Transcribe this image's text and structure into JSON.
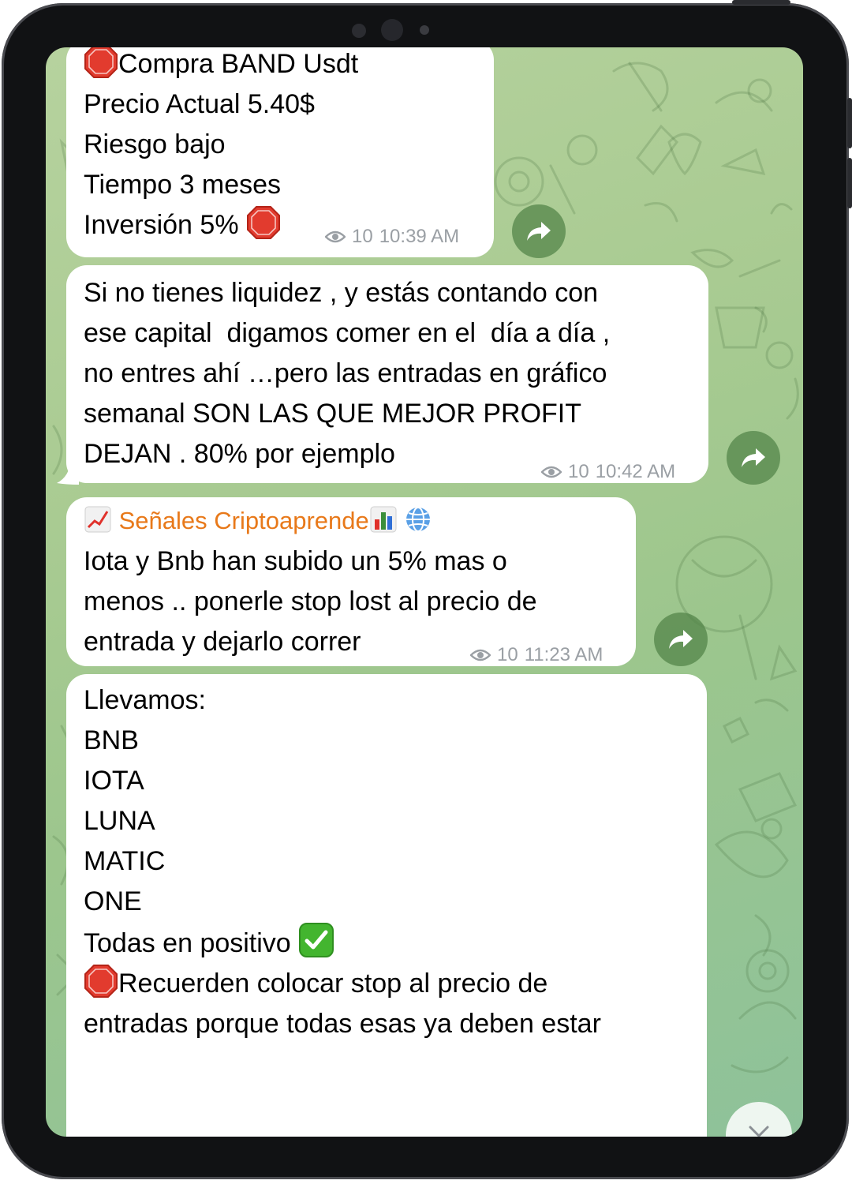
{
  "messages": [
    {
      "lines": [
        "Compra BAND Usdt",
        "Precio Actual 5.40$",
        "Riesgo bajo",
        "Tiempo 3 meses",
        "Inversión 5%"
      ],
      "views": "10",
      "time": "10:39 AM"
    },
    {
      "lines": [
        "Si no tienes liquidez , y estás contando con",
        "ese capital  digamos comer en el  día a día ,",
        "no entres ahí …pero las entradas en gráfico",
        "semanal SON LAS QUE MEJOR PROFIT",
        "DEJAN . 80% por ejemplo"
      ],
      "views": "10",
      "time": "10:42 AM"
    },
    {
      "sender": "Señales Criptoaprende",
      "lines": [
        "Iota y Bnb han subido un 5% mas o",
        "menos .. ponerle stop lost al precio de",
        "entrada y dejarlo correr"
      ],
      "views": "10",
      "time": "11:23 AM"
    },
    {
      "lines": [
        "Llevamos:",
        "BNB",
        "IOTA",
        "LUNA",
        "MATIC",
        "ONE",
        "",
        "Todas en positivo",
        "",
        "Recuerden colocar stop al precio de",
        "entradas porque todas esas ya deben estar"
      ]
    }
  ],
  "icons": {
    "stop": "stop-sign-emoji",
    "check": "check-mark-button-emoji",
    "chart_up": "chart-increasing-emoji",
    "bar_chart": "bar-chart-emoji",
    "globe": "globe-emoji",
    "eye": "eye-icon",
    "share": "forward-arrow-icon",
    "scroll_down": "chevron-down-icon"
  },
  "colors": {
    "sender_name": "#e8791a",
    "bubble": "#ffffff",
    "meta": "#9a9fa4",
    "share_button": "#5a8a4c"
  }
}
